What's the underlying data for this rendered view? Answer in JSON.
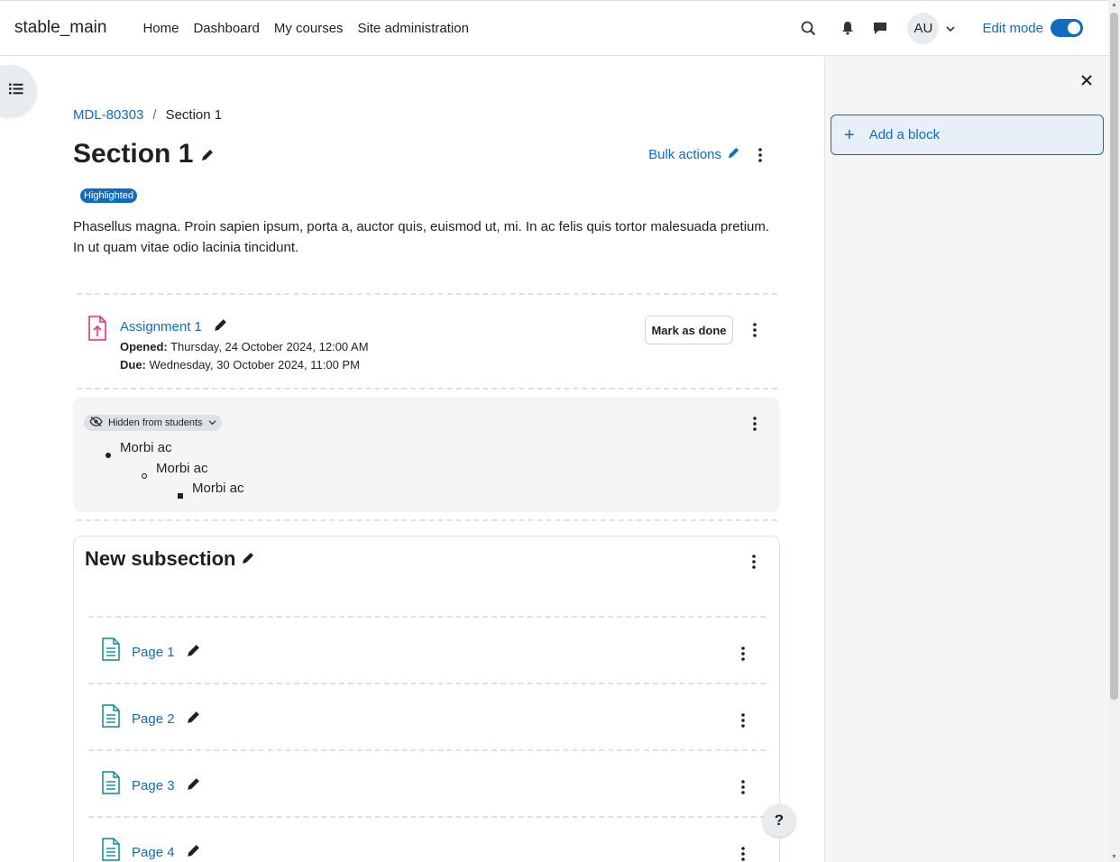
{
  "navbar": {
    "brand": "stable_main",
    "items": [
      "Home",
      "Dashboard",
      "My courses",
      "Site administration"
    ],
    "avatar_initials": "AU",
    "edit_mode_label": "Edit mode"
  },
  "breadcrumb": {
    "course": "MDL-80303",
    "current": "Section 1"
  },
  "section": {
    "title": "Section 1",
    "bulk_actions": "Bulk actions",
    "badge": "Highlighted",
    "summary": "Phasellus magna. Proin sapien ipsum, porta a, auctor quis, euismod ut, mi. In ac felis quis tortor malesuada pretium. In ut quam vitae odio lacinia tincidunt."
  },
  "assignment": {
    "title": "Assignment 1",
    "opened_label": "Opened:",
    "opened_value": " Thursday, 24 October 2024, 12:00 AM",
    "due_label": "Due:",
    "due_value": " Wednesday, 30 October 2024, 11:00 PM",
    "mark_done": "Mark as done"
  },
  "hidden_label": {
    "badge": "Hidden from students",
    "items": [
      "Morbi ac",
      "Morbi ac",
      "Morbi ac"
    ]
  },
  "subsection": {
    "title": "New subsection",
    "pages": [
      "Page 1",
      "Page 2",
      "Page 3",
      "Page 4"
    ]
  },
  "drawer": {
    "add_block": "Add a block"
  },
  "help": "?"
}
